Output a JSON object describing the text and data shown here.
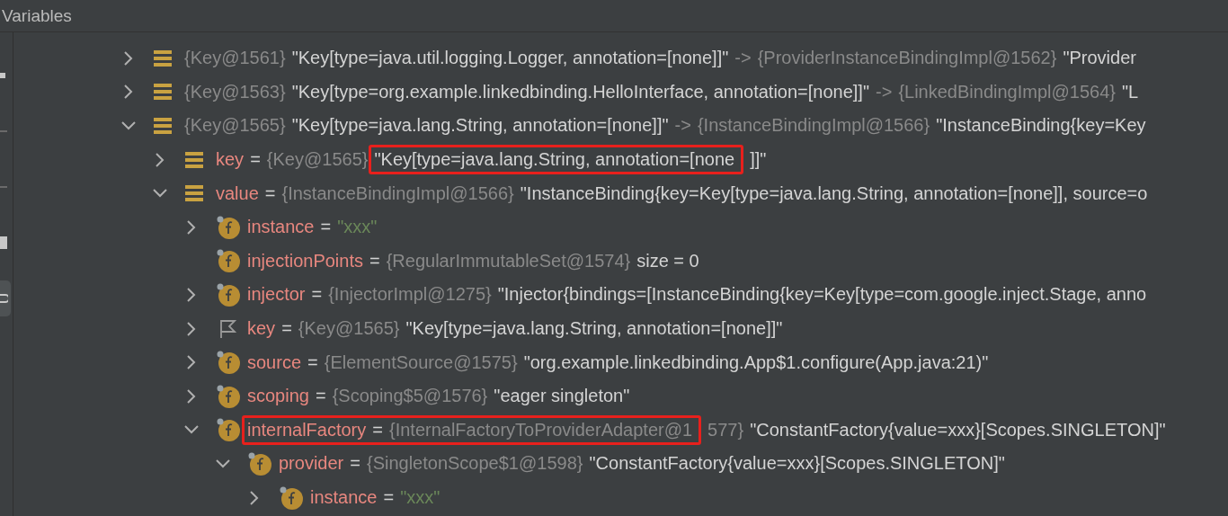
{
  "panel": {
    "title": "Variables"
  },
  "tree": [
    {
      "expanded": false,
      "kind": "list",
      "segments": [
        {
          "kind": "type",
          "text": "{Key@1561}"
        },
        {
          "kind": "text",
          "text": "\"Key[type=java.util.logging.Logger, annotation=[none]]\""
        },
        {
          "kind": "type",
          "text": "->"
        },
        {
          "kind": "type",
          "text": "{ProviderInstanceBindingImpl@1562}"
        },
        {
          "kind": "text",
          "text": "\"Provider"
        }
      ]
    },
    {
      "expanded": false,
      "kind": "list",
      "segments": [
        {
          "kind": "type",
          "text": "{Key@1563}"
        },
        {
          "kind": "text",
          "text": "\"Key[type=org.example.linkedbinding.HelloInterface, annotation=[none]]\""
        },
        {
          "kind": "type",
          "text": "->"
        },
        {
          "kind": "type",
          "text": "{LinkedBindingImpl@1564}"
        },
        {
          "kind": "text",
          "text": "\"L"
        }
      ]
    },
    {
      "expanded": true,
      "kind": "list",
      "segments": [
        {
          "kind": "type",
          "text": "{Key@1565}"
        },
        {
          "kind": "text",
          "text": "\"Key[type=java.lang.String, annotation=[none]]\""
        },
        {
          "kind": "type",
          "text": "->"
        },
        {
          "kind": "type",
          "text": "{InstanceBindingImpl@1566}"
        },
        {
          "kind": "text",
          "text": "\"InstanceBinding{key=Key"
        }
      ],
      "children": [
        {
          "expanded": false,
          "kind": "list",
          "segments": [
            {
              "kind": "name",
              "text": "key"
            },
            {
              "kind": "text",
              "text": "="
            },
            {
              "kind": "type",
              "text": "{Key@1565}"
            },
            {
              "kind": "text",
              "text": "\"Key[type=java.lang.String, annotation=[none",
              "boxed": true
            },
            {
              "kind": "text",
              "text": "]]\""
            }
          ]
        },
        {
          "expanded": true,
          "kind": "list",
          "segments": [
            {
              "kind": "name",
              "text": "value"
            },
            {
              "kind": "text",
              "text": "="
            },
            {
              "kind": "type",
              "text": "{InstanceBindingImpl@1566}"
            },
            {
              "kind": "text",
              "text": "\"InstanceBinding{key=Key[type=java.lang.String, annotation=[none]], source=o"
            }
          ],
          "children": [
            {
              "expanded": false,
              "kind": "field",
              "segments": [
                {
                  "kind": "name",
                  "text": "instance"
                },
                {
                  "kind": "text",
                  "text": "="
                },
                {
                  "kind": "string",
                  "text": "\"xxx\""
                }
              ]
            },
            {
              "kind": "field",
              "segments": [
                {
                  "kind": "name",
                  "text": "injectionPoints"
                },
                {
                  "kind": "text",
                  "text": "="
                },
                {
                  "kind": "type",
                  "text": "{RegularImmutableSet@1574}"
                },
                {
                  "kind": "text",
                  "text": "size = 0"
                }
              ]
            },
            {
              "expanded": false,
              "kind": "field",
              "segments": [
                {
                  "kind": "name",
                  "text": "injector"
                },
                {
                  "kind": "text",
                  "text": "="
                },
                {
                  "kind": "type",
                  "text": "{InjectorImpl@1275}"
                },
                {
                  "kind": "text",
                  "text": "\"Injector{bindings=[InstanceBinding{key=Key[type=com.google.inject.Stage, anno"
                }
              ]
            },
            {
              "expanded": false,
              "kind": "flag",
              "segments": [
                {
                  "kind": "name",
                  "text": "key"
                },
                {
                  "kind": "text",
                  "text": "="
                },
                {
                  "kind": "type",
                  "text": "{Key@1565}"
                },
                {
                  "kind": "text",
                  "text": "\"Key[type=java.lang.String, annotation=[none]]\""
                }
              ]
            },
            {
              "expanded": false,
              "kind": "field",
              "segments": [
                {
                  "kind": "name",
                  "text": "source"
                },
                {
                  "kind": "text",
                  "text": "="
                },
                {
                  "kind": "type",
                  "text": "{ElementSource@1575}"
                },
                {
                  "kind": "text",
                  "text": "\"org.example.linkedbinding.App$1.configure(App.java:21)\""
                }
              ]
            },
            {
              "expanded": false,
              "kind": "field",
              "segments": [
                {
                  "kind": "name",
                  "text": "scoping"
                },
                {
                  "kind": "text",
                  "text": "="
                },
                {
                  "kind": "type",
                  "text": "{Scoping$5@1576}"
                },
                {
                  "kind": "text",
                  "text": "\"eager singleton\""
                }
              ]
            },
            {
              "expanded": true,
              "kind": "field",
              "segments": [
                {
                  "kind": "name",
                  "text": "internalFactory",
                  "boxed": true
                },
                {
                  "kind": "text",
                  "text": "=",
                  "boxed": true
                },
                {
                  "kind": "type",
                  "text": "{InternalFactoryToProviderAdapter@1",
                  "boxed": true
                },
                {
                  "kind": "type",
                  "text": "577}"
                },
                {
                  "kind": "text",
                  "text": "\"ConstantFactory{value=xxx}[Scopes.SINGLETON]\""
                }
              ],
              "children": [
                {
                  "expanded": true,
                  "kind": "field",
                  "segments": [
                    {
                      "kind": "name",
                      "text": "provider"
                    },
                    {
                      "kind": "text",
                      "text": "="
                    },
                    {
                      "kind": "type",
                      "text": "{SingletonScope$1@1598}"
                    },
                    {
                      "kind": "text",
                      "text": "\"ConstantFactory{value=xxx}[Scopes.SINGLETON]\""
                    }
                  ],
                  "children": [
                    {
                      "expanded": false,
                      "kind": "field",
                      "segments": [
                        {
                          "kind": "name",
                          "text": "instance"
                        },
                        {
                          "kind": "text",
                          "text": "="
                        },
                        {
                          "kind": "string",
                          "text": "\"xxx\""
                        }
                      ]
                    }
                  ]
                }
              ]
            }
          ]
        }
      ]
    }
  ]
}
